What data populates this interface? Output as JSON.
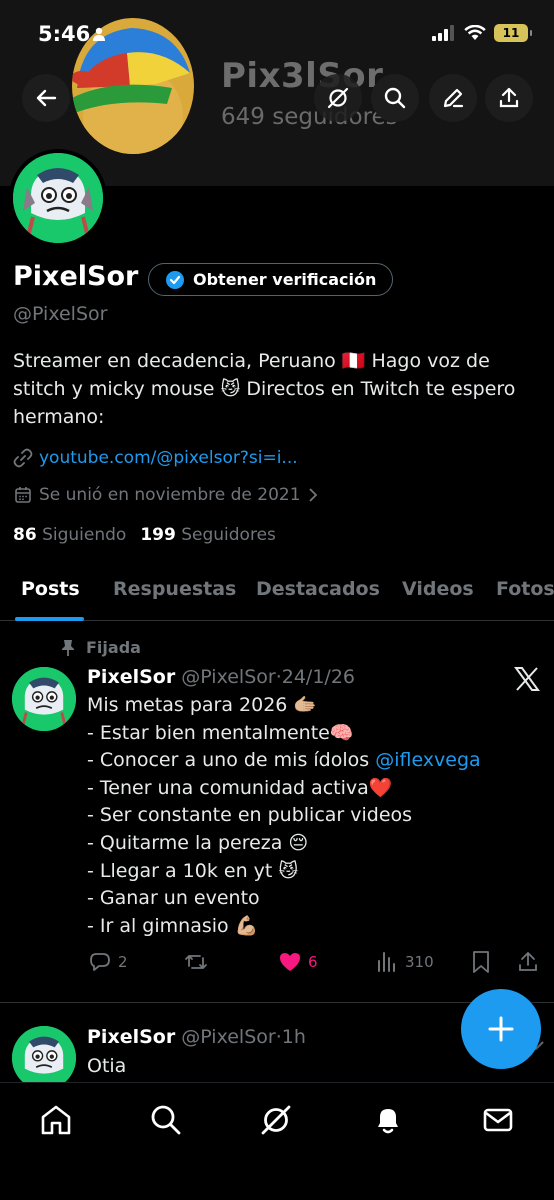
{
  "status": {
    "time": "5:46",
    "battery": "11"
  },
  "header": {
    "title": "Pix3lSor",
    "subtitle": "649 seguidores"
  },
  "profile": {
    "name": "PixelSor",
    "verify_label": "Obtener verificación",
    "handle": "@PixelSor",
    "bio_lines": [
      "Streamer en decadencia, Peruano 🇵🇪 Hago voz de",
      "stitch y micky mouse 😼 Directos en Twitch te espero",
      "hermano:"
    ],
    "link": "youtube.com/@pixelsor?si=i...",
    "joined": "Se unió en noviembre de 2021",
    "following_count": "86",
    "following_label": "Siguiendo",
    "followers_count": "199",
    "followers_label": "Seguidores"
  },
  "tabs": [
    "Posts",
    "Respuestas",
    "Destacados",
    "Videos",
    "Fotos"
  ],
  "posts": [
    {
      "pinned_label": "Fijada",
      "name": "PixelSor",
      "handle": "@PixelSor",
      "time": "24/1/26",
      "lines": [
        "Mis metas para 2026 🫱🏼",
        "- Estar bien mentalmente🧠",
        "- Conocer a uno de mis ídolos ",
        "- Tener una comunidad activa❤️",
        "- Ser constante en publicar videos",
        "- Quitarme la pereza 😔",
        "- Llegar a 10k en yt 😼",
        "- Ganar un evento",
        "- Ir al gimnasio 💪🏼"
      ],
      "mention": "@iflexvega",
      "replies": "2",
      "likes": "6",
      "views": "310"
    },
    {
      "name": "PixelSor",
      "handle": "@PixelSor",
      "time": "1h",
      "text": "Otia"
    }
  ],
  "colors": {
    "accent": "#1d9bf0",
    "like": "#f91880",
    "avatar_bg": "#18c86a"
  }
}
